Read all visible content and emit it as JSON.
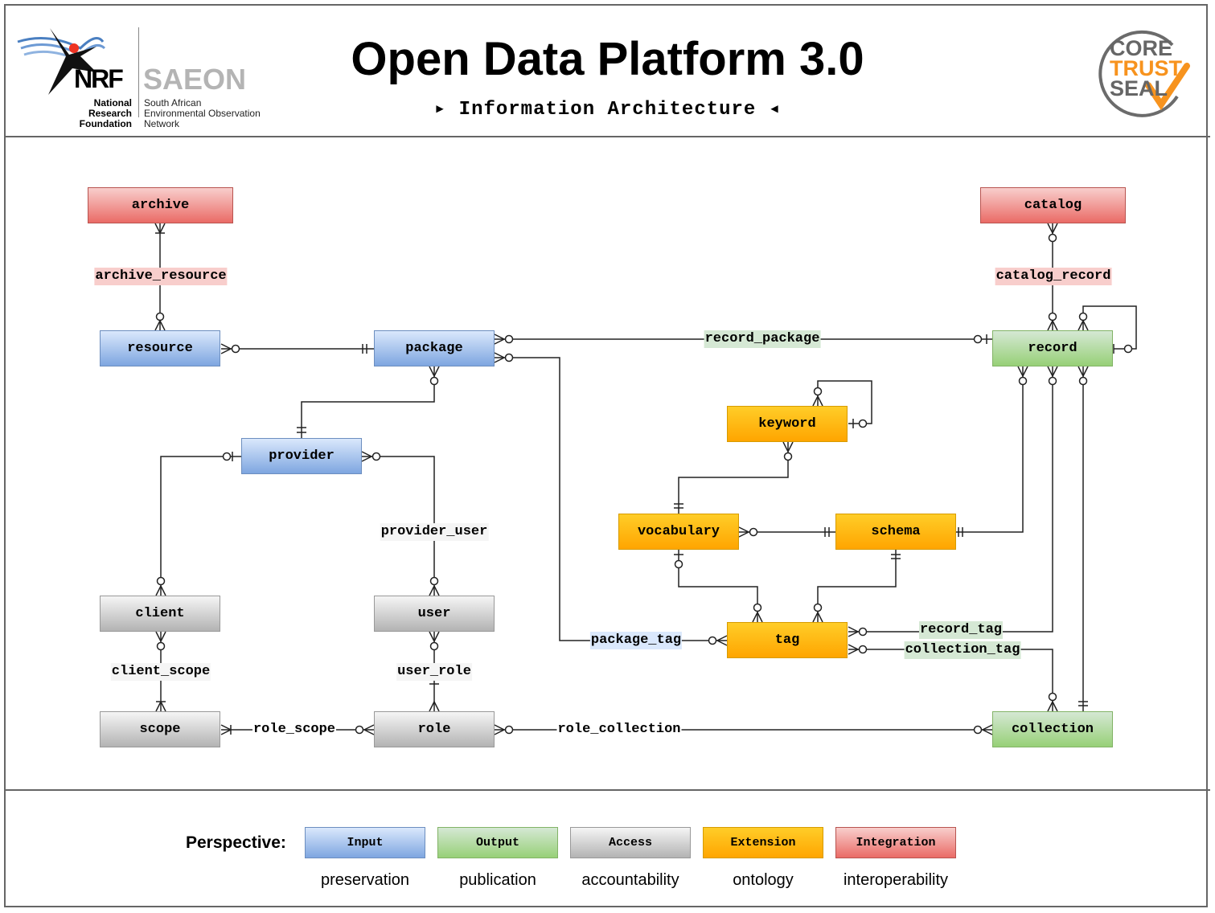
{
  "header": {
    "title": "Open Data Platform 3.0",
    "subtitle": "Information Architecture",
    "logo_left": {
      "org1": "NRF",
      "org1_name": "National Research Foundation",
      "org2": "SAEON",
      "org2_name": "South African Environmental Observation Network"
    },
    "logo_right": {
      "line1": "CORE",
      "line2": "TRUST",
      "line3": "SEAL"
    }
  },
  "entities": {
    "archive": "archive",
    "catalog": "catalog",
    "resource": "resource",
    "package": "package",
    "record": "record",
    "keyword": "keyword",
    "provider": "provider",
    "vocabulary": "vocabulary",
    "schema": "schema",
    "client": "client",
    "user": "user",
    "tag": "tag",
    "scope": "scope",
    "role": "role",
    "collection": "collection"
  },
  "relationships": {
    "archive_resource": "archive_resource",
    "catalog_record": "catalog_record",
    "record_package": "record_package",
    "provider_user": "provider_user",
    "client_scope": "client_scope",
    "user_role": "user_role",
    "package_tag": "package_tag",
    "record_tag": "record_tag",
    "collection_tag": "collection_tag",
    "role_scope": "role_scope",
    "role_collection": "role_collection"
  },
  "legend": {
    "label": "Perspective:",
    "items": [
      {
        "name": "Input",
        "desc": "preservation",
        "color": "#7ea6e0"
      },
      {
        "name": "Output",
        "desc": "publication",
        "color": "#97d077"
      },
      {
        "name": "Access",
        "desc": "accountability",
        "color": "#b3b3b3"
      },
      {
        "name": "Extension",
        "desc": "ontology",
        "color": "#ffa500"
      },
      {
        "name": "Integration",
        "desc": "interoperability",
        "color": "#ea6b66"
      }
    ]
  }
}
